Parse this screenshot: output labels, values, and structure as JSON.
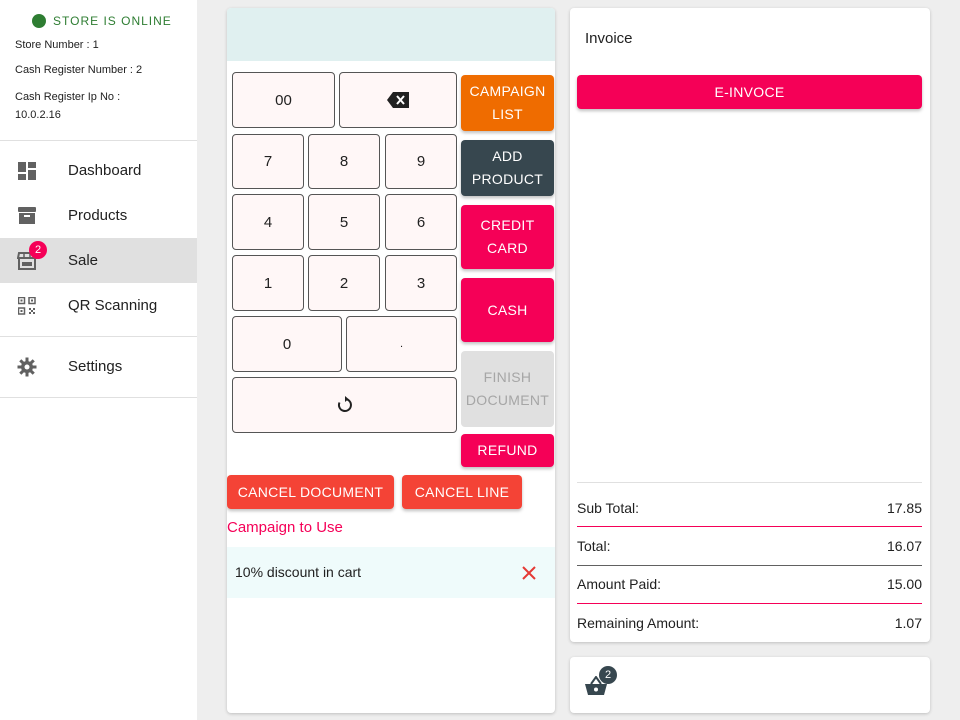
{
  "sidebar": {
    "status": "STORE IS ONLINE",
    "store_number": "Store Number : 1",
    "register_number": "Cash Register Number : 2",
    "register_ip_label": "Cash Register Ip No :",
    "register_ip_value": "10.0.2.16",
    "nav": [
      {
        "label": "Dashboard",
        "icon": "dashboard-icon"
      },
      {
        "label": "Products",
        "icon": "archive-icon"
      },
      {
        "label": "Sale",
        "icon": "store-icon",
        "badge": "2"
      },
      {
        "label": "QR Scanning",
        "icon": "qr-code-icon"
      },
      {
        "label": "Settings",
        "icon": "gear-icon"
      }
    ]
  },
  "keypad": {
    "k00": "00",
    "k7": "7",
    "k8": "8",
    "k9": "9",
    "k4": "4",
    "k5": "5",
    "k6": "6",
    "k1": "1",
    "k2": "2",
    "k3": "3",
    "k0": "0",
    "kdot": "."
  },
  "actions": {
    "campaign_list": [
      "CAMPAIGN",
      "LIST"
    ],
    "add_product": [
      "ADD",
      "PRODUCT"
    ],
    "credit_card": [
      "CREDIT",
      "CARD"
    ],
    "cash": "CASH",
    "finish_document": [
      "FINISH",
      "DOCUMENT"
    ],
    "refund": "REFUND",
    "cancel_document": "CANCEL DOCUMENT",
    "cancel_line": "CANCEL LINE"
  },
  "campaign": {
    "title": "Campaign to Use",
    "item": "10% discount in cart"
  },
  "invoice": {
    "title": "Invoice",
    "e_invoice": "E-INVOCE",
    "sub_total_label": "Sub Total:",
    "sub_total": "17.85",
    "total_label": "Total:",
    "total": "16.07",
    "amount_paid_label": "Amount Paid:",
    "amount_paid": "15.00",
    "remaining_label": "Remaining Amount:",
    "remaining": "1.07"
  },
  "cart": {
    "count": "2"
  },
  "colors": {
    "online": "#2e7d32",
    "pink": "#f50057",
    "orange": "#ef6c00",
    "slate": "#37474f",
    "red": "#f44336"
  }
}
